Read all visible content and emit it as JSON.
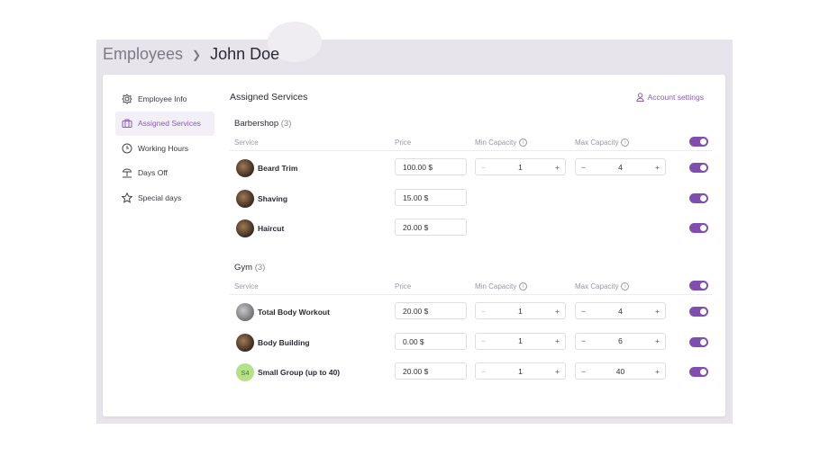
{
  "breadcrumb": {
    "parent": "Employees",
    "current": "John Doe"
  },
  "sidebar": {
    "items": [
      {
        "label": "Employee Info",
        "icon": "gear-flower-icon"
      },
      {
        "label": "Assigned Services",
        "icon": "briefcase-icon",
        "active": true
      },
      {
        "label": "Working Hours",
        "icon": "clock-icon"
      },
      {
        "label": "Days Off",
        "icon": "beach-umbrella-icon"
      },
      {
        "label": "Special days",
        "icon": "star-icon"
      }
    ]
  },
  "main": {
    "title": "Assigned Services",
    "account_settings": "Account settings",
    "columns": {
      "service": "Service",
      "price": "Price",
      "min": "Min Capacity",
      "max": "Max Capacity"
    },
    "groups": [
      {
        "name": "Barbershop",
        "count": "(3)",
        "services": [
          {
            "name": "Beard Trim",
            "price": "100.00 $",
            "min": "1",
            "max": "4",
            "enabled": true
          },
          {
            "name": "Shaving",
            "price": "15.00 $",
            "enabled": true
          },
          {
            "name": "Haircut",
            "price": "20.00 $",
            "enabled": true
          }
        ]
      },
      {
        "name": "Gym",
        "count": "(3)",
        "services": [
          {
            "name": "Total Body Workout",
            "price": "20.00 $",
            "min": "1",
            "max": "4",
            "enabled": true
          },
          {
            "name": "Body Building",
            "price": "0.00 $",
            "min": "1",
            "max": "6",
            "enabled": true
          },
          {
            "name": "Small Group (up to 40)",
            "initials": "S4",
            "price": "20.00 $",
            "min": "1",
            "max": "40",
            "enabled": true
          }
        ]
      }
    ]
  }
}
